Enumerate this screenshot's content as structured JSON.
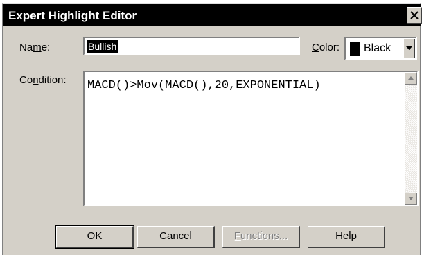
{
  "window": {
    "title": "Expert Highlight Editor"
  },
  "form": {
    "name_label_pre": "Na",
    "name_label_u": "m",
    "name_label_post": "e:",
    "name_value": "Bullish",
    "color_label_u": "C",
    "color_label_post": "olor:",
    "color_value": "Black",
    "color_swatch": "#000000",
    "condition_label_pre": "Co",
    "condition_label_u": "n",
    "condition_label_post": "dition:",
    "condition_value": "MACD()>Mov(MACD(),20,EXPONENTIAL)"
  },
  "buttons": {
    "ok": "OK",
    "cancel": "Cancel",
    "functions_u": "F",
    "functions_post": "unctions...",
    "help_u": "H",
    "help_post": "elp"
  },
  "icons": {
    "close": "close-icon",
    "dropdown": "chevron-down-icon",
    "scroll_up": "arrow-up-icon",
    "scroll_down": "arrow-down-icon"
  }
}
